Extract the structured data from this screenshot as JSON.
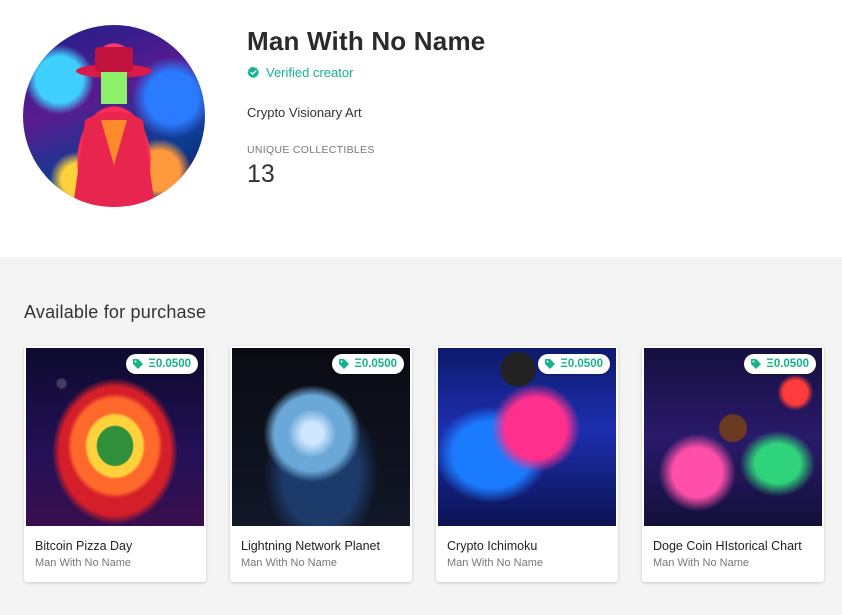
{
  "profile": {
    "name": "Man With No Name",
    "verified_label": "Verified creator",
    "bio": "Crypto Visionary Art",
    "stat_label": "UNIQUE COLLECTIBLES",
    "stat_value": "13"
  },
  "colors": {
    "accent": "#16b28c",
    "section_bg": "#f4f4f4"
  },
  "icons": {
    "verified": "check-badge-icon",
    "price": "tag-icon"
  },
  "listing": {
    "title": "Available for purchase",
    "cards": [
      {
        "title": "Bitcoin Pizza Day",
        "creator": "Man With No Name",
        "price": "Ξ0.0500"
      },
      {
        "title": "Lightning Network Planet",
        "creator": "Man With No Name",
        "price": "Ξ0.0500"
      },
      {
        "title": "Crypto Ichimoku",
        "creator": "Man With No Name",
        "price": "Ξ0.0500"
      },
      {
        "title": "Doge Coin HIstorical Chart",
        "creator": "Man With No Name",
        "price": "Ξ0.0500"
      }
    ]
  }
}
